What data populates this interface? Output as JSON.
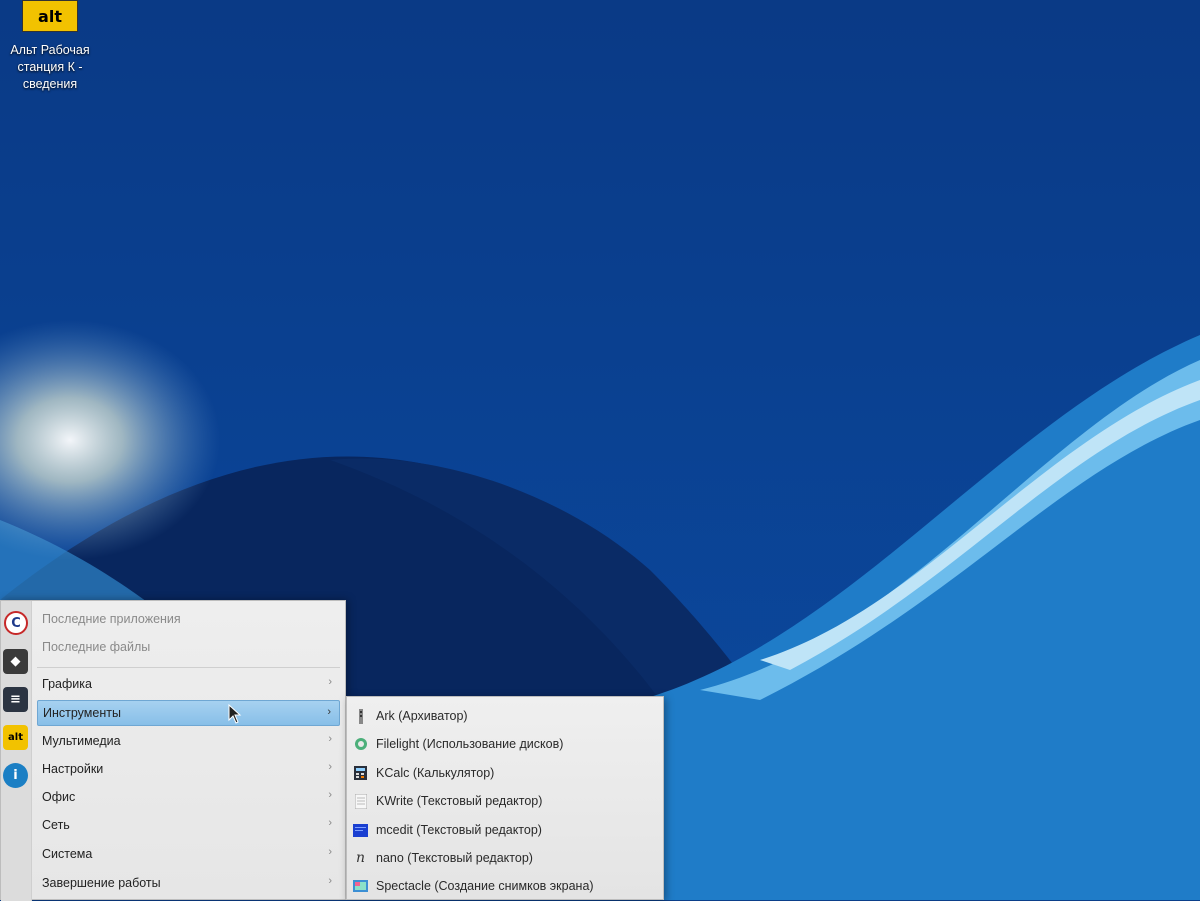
{
  "desktop": {
    "icon_logo_text": "alt",
    "icon_label_line1": "Альт Рабочая",
    "icon_label_line2": "станция К  -",
    "icon_label_line3": "сведения"
  },
  "menu": {
    "recent_apps": "Последние приложения",
    "recent_files": "Последние файлы",
    "categories": [
      {
        "label": "Графика"
      },
      {
        "label": "Инструменты"
      },
      {
        "label": "Мультимедиа"
      },
      {
        "label": "Настройки"
      },
      {
        "label": "Офис"
      },
      {
        "label": "Сеть"
      },
      {
        "label": "Система"
      },
      {
        "label": "Завершение работы"
      }
    ],
    "arrow": "›"
  },
  "favorites": [
    {
      "icon": "c-logo-icon",
      "glyph": "C",
      "color": "#1f3a8a"
    },
    {
      "icon": "gem-icon",
      "glyph": "◆",
      "color": "#444444"
    },
    {
      "icon": "sliders-icon",
      "glyph": "≡",
      "color": "#2b3442"
    },
    {
      "icon": "alt-logo-icon",
      "glyph": "alt",
      "color": "#f2c200"
    },
    {
      "icon": "info-icon",
      "glyph": "i",
      "color": "#1b7fc4"
    }
  ],
  "submenu": {
    "items": [
      {
        "label": "Ark (Архиватор)",
        "icon": "archive-icon"
      },
      {
        "label": "Filelight (Использование дисков)",
        "icon": "disk-usage-icon"
      },
      {
        "label": "KCalc (Калькулятор)",
        "icon": "calculator-icon"
      },
      {
        "label": "KWrite (Текстовый редактор)",
        "icon": "text-editor-icon"
      },
      {
        "label": "mcedit (Текстовый редактор)",
        "icon": "terminal-editor-icon"
      },
      {
        "label": "nano (Текстовый редактор)",
        "icon": "nano-icon"
      },
      {
        "label": "Spectacle (Создание снимков экрана)",
        "icon": "screenshot-icon"
      }
    ]
  },
  "colors": {
    "desktop_bg": "#0b3f8a",
    "highlight": "#88bfe8",
    "menu_bg": "#e9e9e9"
  }
}
